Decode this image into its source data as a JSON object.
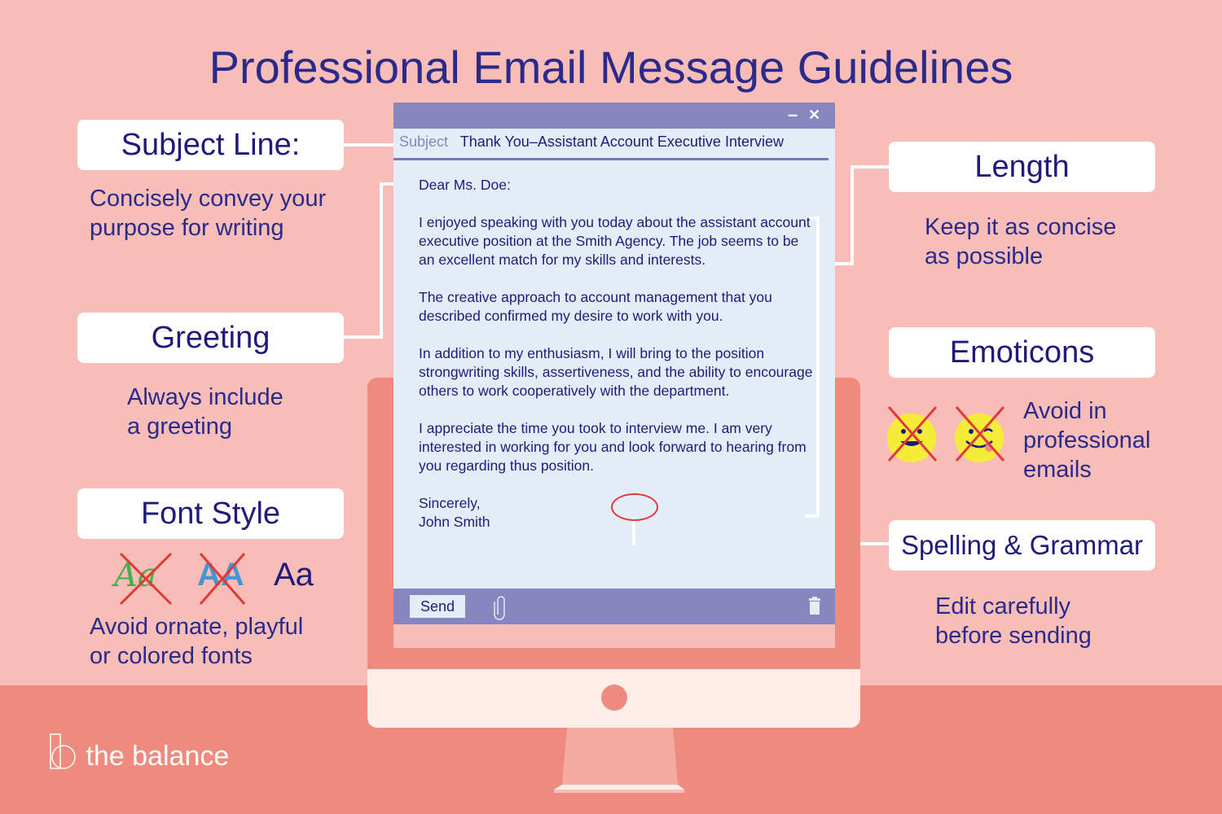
{
  "title": "Professional Email Message Guidelines",
  "sections": {
    "subject": {
      "label": "Subject Line:",
      "desc_lines": [
        "Concisely convey your",
        "purpose for writing"
      ]
    },
    "greeting": {
      "label": "Greeting",
      "desc_lines": [
        "Always include",
        "a greeting"
      ]
    },
    "font": {
      "label": "Font Style",
      "samples": [
        "Aa",
        "AA",
        "Aa"
      ],
      "desc_lines": [
        "Avoid ornate, playful",
        "or colored fonts"
      ]
    },
    "length": {
      "label": "Length",
      "desc_lines": [
        "Keep it as concise",
        "as possible"
      ]
    },
    "emoticons": {
      "label": "Emoticons",
      "desc_lines": [
        "Avoid in",
        "professional",
        "emails"
      ]
    },
    "spelling": {
      "label": "Spelling & Grammar",
      "desc_lines": [
        "Edit carefully",
        "before sending"
      ]
    }
  },
  "email": {
    "subject_label": "Subject",
    "subject_value": "Thank You–Assistant Account Executive Interview",
    "minimize": "–",
    "close": "✕",
    "greeting": "Dear Ms. Doe:",
    "paragraphs": [
      "I enjoyed speaking with you today about the assistant account executive position at the Smith Agency. The job seems to be an excellent match for my skills and interests.",
      "The creative approach to account management that you described confirmed my desire to work with you.",
      "In addition to my enthusiasm, I will bring to the position strongwriting skills, assertiveness, and the ability to encourage others to work cooperatively with the department.",
      "I appreciate the time you took to interview me. I am very interested in working for you and look forward to hearing from you regarding thus position."
    ],
    "closing": "Sincerely,",
    "signature": "John Smith",
    "send_label": "Send"
  },
  "brand": "the balance",
  "colors": {
    "accent": "#2a2a8c",
    "background": "#f7bdb6",
    "floor": "#ef8a7e",
    "email_bar": "#8786be",
    "error_mark": "#e0393a"
  }
}
